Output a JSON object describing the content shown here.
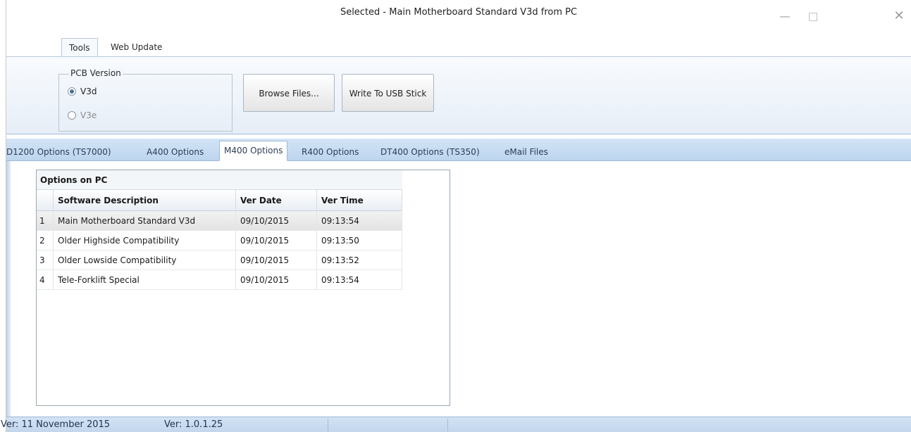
{
  "window": {
    "title": "Selected - Main Motherboard Standard V3d from PC",
    "controls": {
      "minimize": "—",
      "close": "✕"
    }
  },
  "ribbon": {
    "tabs": [
      "Tools",
      "Web Update"
    ],
    "active_tab": "Tools",
    "pcb_group": {
      "title": "PCB Version",
      "options": [
        {
          "label": "V3d",
          "checked": true,
          "enabled": true
        },
        {
          "label": "V3e",
          "checked": false,
          "enabled": false
        }
      ]
    },
    "buttons": {
      "browse": "Browse Files...",
      "write": "Write To USB Stick"
    }
  },
  "tabs": [
    "D1200 Options (TS7000)",
    "A400 Options",
    "M400 Options",
    "R400 Options",
    "DT400 Options (TS350)",
    "eMail Files"
  ],
  "active_tab": "M400 Options",
  "grid": {
    "title": "Options on PC",
    "columns": [
      "",
      "Software Description",
      "Ver Date",
      "Ver Time"
    ],
    "rows": [
      {
        "num": "1",
        "desc": "Main Motherboard Standard V3d",
        "date": "09/10/2015",
        "time": "09:13:54",
        "selected": true
      },
      {
        "num": "2",
        "desc": "Older Highside Compatibility",
        "date": "09/10/2015",
        "time": "09:13:50",
        "selected": false
      },
      {
        "num": "3",
        "desc": "Older Lowside Compatibility",
        "date": "09/10/2015",
        "time": "09:13:52",
        "selected": false
      },
      {
        "num": "4",
        "desc": "Tele-Forklift Special",
        "date": "09/10/2015",
        "time": "09:13:54",
        "selected": false
      }
    ]
  },
  "status": {
    "left": "Ver: 11 November 2015",
    "right": "Ver: 1.0.1.25"
  }
}
